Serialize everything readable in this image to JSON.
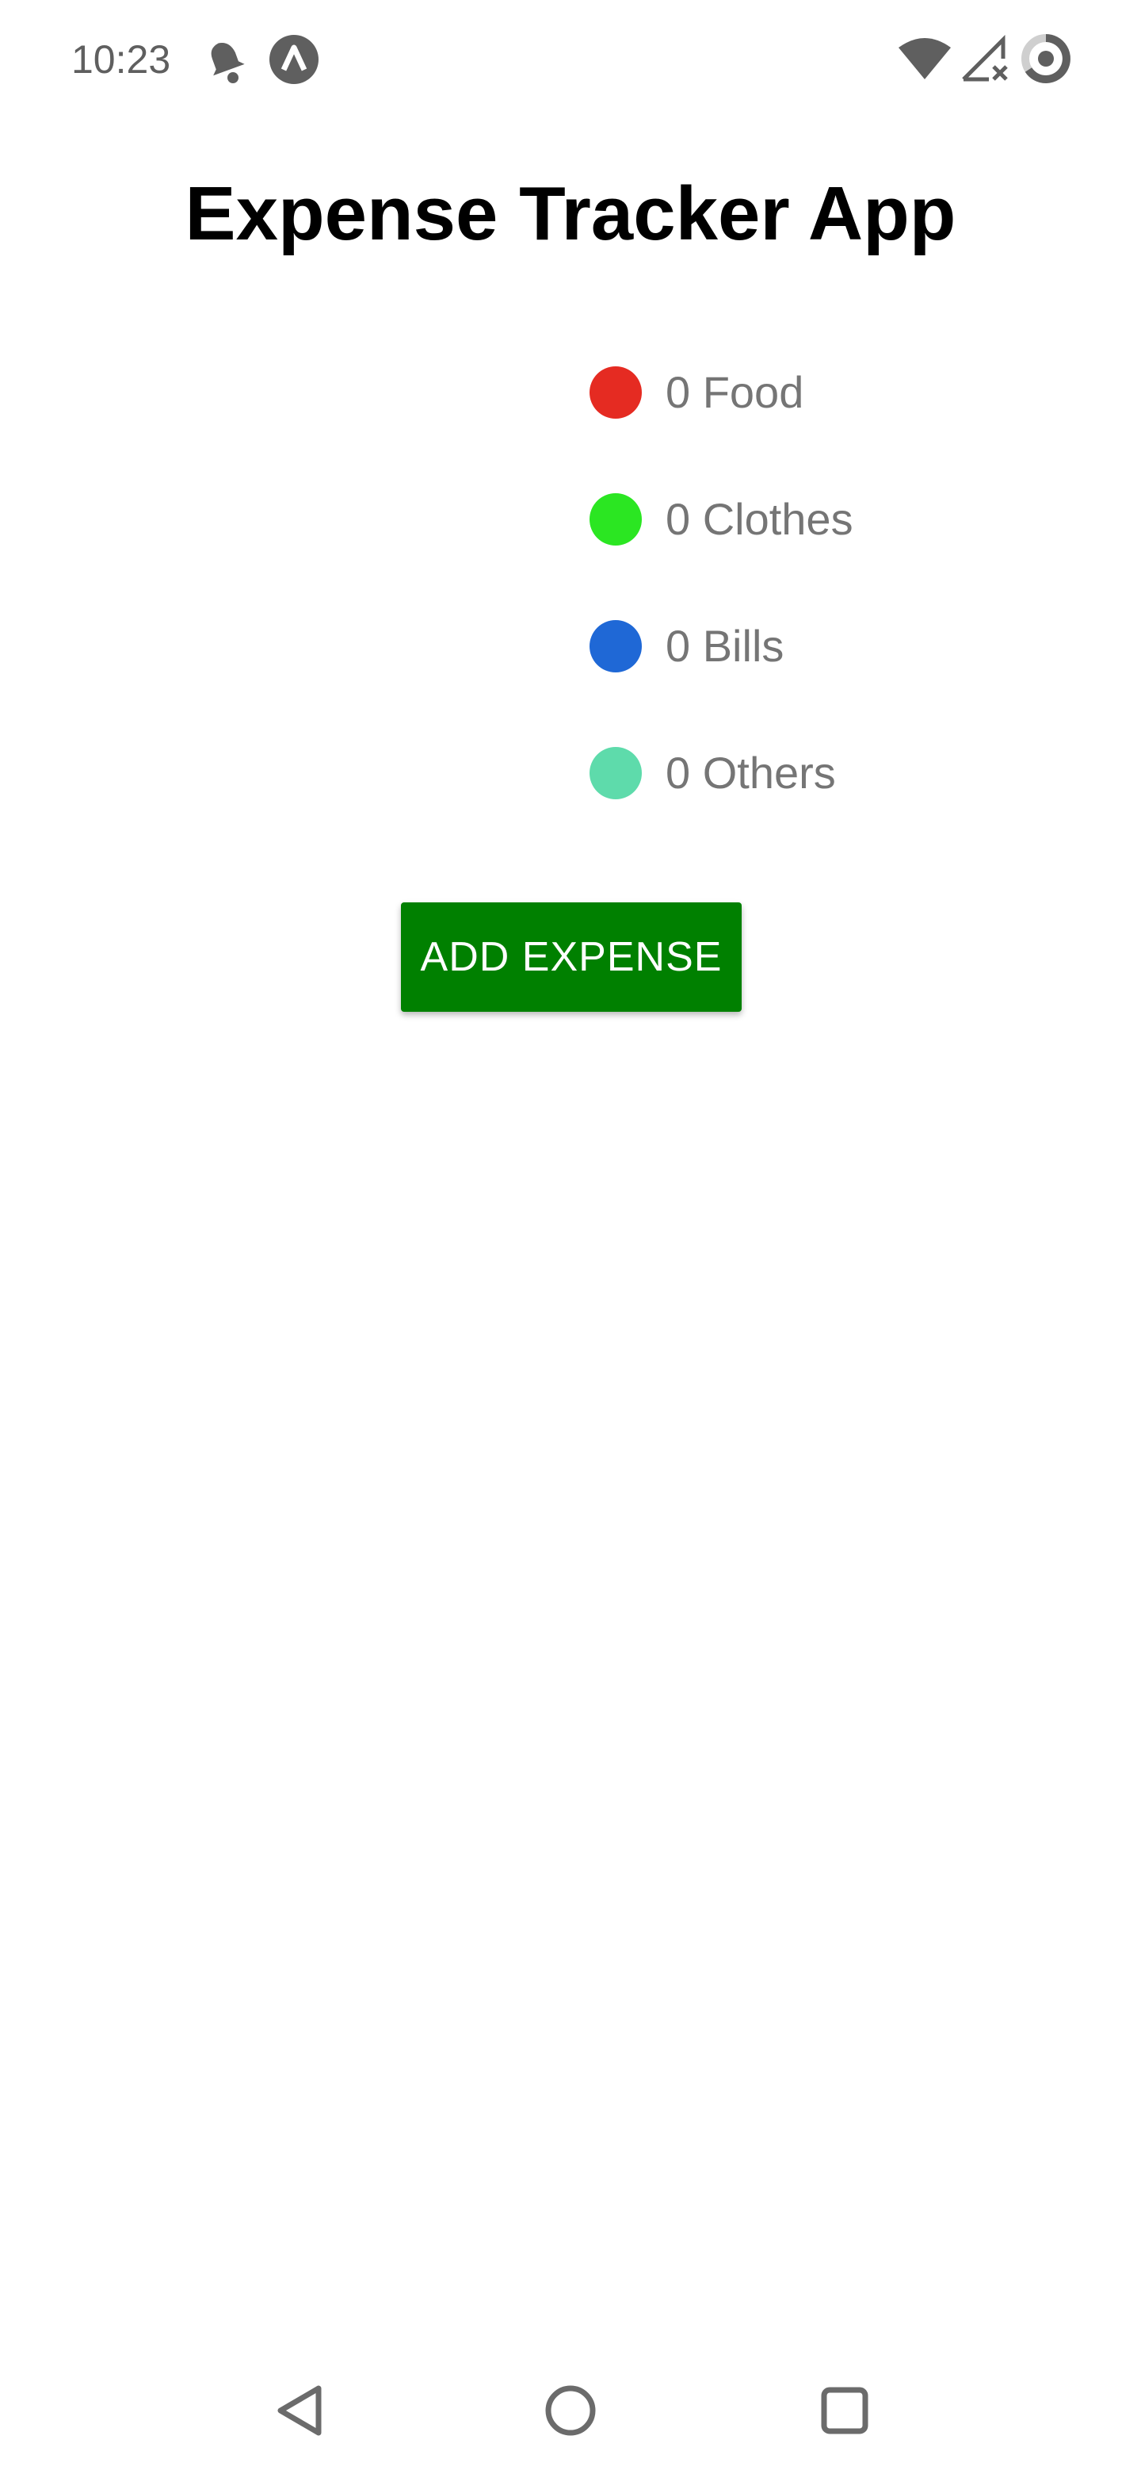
{
  "status_bar": {
    "time": "10:23",
    "icons": [
      "notification-bell-icon",
      "app-logo-icon",
      "wifi-icon",
      "signal-icon",
      "battery-ring-icon"
    ]
  },
  "app": {
    "title": "Expense Tracker App"
  },
  "legend": {
    "items": [
      {
        "label": "0 Food",
        "color": "#e52b22"
      },
      {
        "label": "0 Clothes",
        "color": "#2be622"
      },
      {
        "label": "0 Bills",
        "color": "#1f68d6"
      },
      {
        "label": "0 Others",
        "color": "#5edbab"
      }
    ]
  },
  "actions": {
    "add_expense_label": "ADD EXPENSE",
    "button_color": "#008000"
  },
  "nav_bar": {
    "icons": [
      "back-triangle-icon",
      "home-circle-icon",
      "recents-square-icon"
    ]
  }
}
